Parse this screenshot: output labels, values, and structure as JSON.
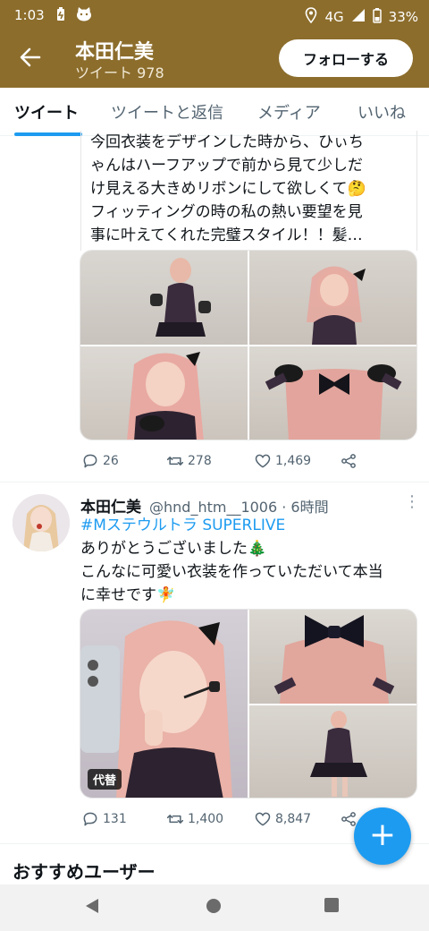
{
  "status_bar": {
    "time": "1:03",
    "network": "4G",
    "battery": "33%",
    "icons": [
      "battery-saver-icon",
      "cat-app-icon",
      "location-icon",
      "signal-icon",
      "battery-icon"
    ]
  },
  "header": {
    "title": "本田仁美",
    "subtitle": "ツイート 978",
    "follow_label": "フォローする"
  },
  "tabs": [
    {
      "label": "ツイート",
      "active": true
    },
    {
      "label": "ツイートと返信",
      "active": false
    },
    {
      "label": "メディア",
      "active": false
    },
    {
      "label": "いいね",
      "active": false
    }
  ],
  "tweet1": {
    "text_lines": [
      "今回衣装をデザインした時から、ひぃち",
      "ゃんはハーフアップで前から見て少しだ",
      "け見える大きめリボンにして欲しくて🤔",
      "フィッティングの時の私の熱い要望を見",
      "事に叶えてくれた完璧スタイル！！髪…"
    ],
    "replies": "26",
    "retweets": "278",
    "likes": "1,469"
  },
  "tweet2": {
    "name": "本田仁美",
    "handle": "@hnd_htm__1006 · 6時間",
    "hashtag": "#Mステウルトラ SUPERLIVE",
    "text_lines": [
      "ありがとうございました🎄",
      "こんなに可愛い衣装を作っていただいて本当",
      "に幸せです🧚"
    ],
    "alt_badge": "代替",
    "replies": "131",
    "retweets": "1,400",
    "likes": "8,847"
  },
  "recommended_title": "おすすめユーザー",
  "colors": {
    "header": "#8c6d2c",
    "accent": "#1d9bf0",
    "text_secondary": "#536471"
  }
}
